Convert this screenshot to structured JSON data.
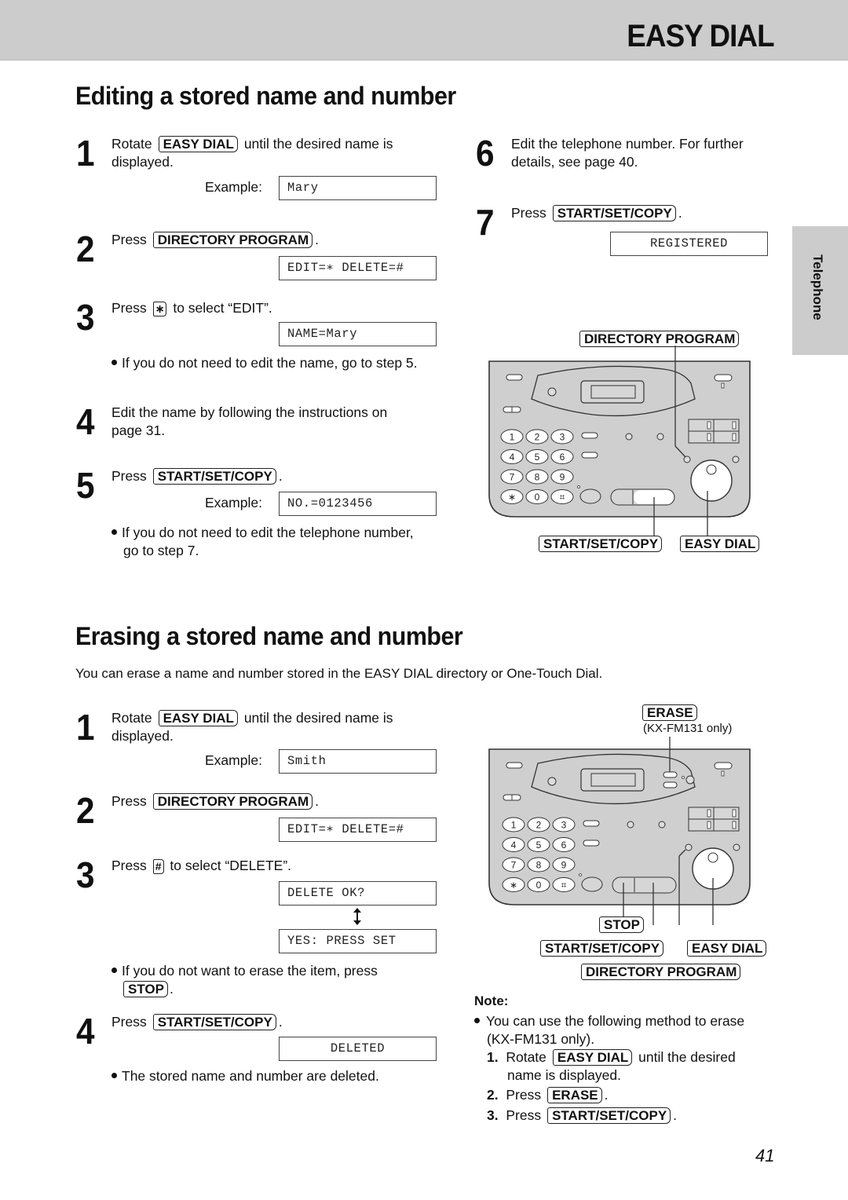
{
  "header": {
    "title": "EASY DIAL"
  },
  "side_tab": {
    "label": "Telephone"
  },
  "edit_section": {
    "title": "Editing a stored name and number",
    "steps": [
      {
        "num": "1",
        "before": "Rotate",
        "key": "EASY DIAL",
        "after": "until the desired name is",
        "line2": "displayed.",
        "example_label": "Example:",
        "lcd": "Mary"
      },
      {
        "num": "2",
        "before": "Press",
        "key": "DIRECTORY PROGRAM",
        "after": ".",
        "lcd": "EDIT=∗ DELETE=#"
      },
      {
        "num": "3",
        "before": "Press",
        "key": "∗",
        "after": "to select “EDIT”.",
        "lcd": "NAME=Mary",
        "bullet": "If you do not need to edit the name, go to step 5."
      },
      {
        "num": "4",
        "line1": "Edit the name by following the instructions on",
        "line2": "page 31."
      },
      {
        "num": "5",
        "before": "Press",
        "key": "START/SET/COPY",
        "after": ".",
        "example_label": "Example:",
        "lcd": "NO.=0123456",
        "bullet_line1": "If you do not need to edit the telephone number,",
        "bullet_line2": "go to step 7."
      },
      {
        "num": "6",
        "line1": "Edit the telephone number. For further",
        "line2": "details, see page 40."
      },
      {
        "num": "7",
        "before": "Press",
        "key": "START/SET/COPY",
        "after": ".",
        "lcd": "REGISTERED"
      }
    ],
    "diagram": {
      "callouts": [
        "DIRECTORY PROGRAM",
        "START/SET/COPY",
        "EASY DIAL"
      ],
      "keypad": [
        "1",
        "2",
        "3",
        "4",
        "5",
        "6",
        "7",
        "8",
        "9",
        "∗",
        "0",
        "⌗"
      ]
    }
  },
  "erase_section": {
    "title": "Erasing a stored name and number",
    "intro": "You can erase a name and number stored in the EASY DIAL directory or One-Touch Dial.",
    "steps": [
      {
        "num": "1",
        "before": "Rotate",
        "key": "EASY DIAL",
        "after": "until the desired name is",
        "line2": "displayed.",
        "example_label": "Example:",
        "lcd": "Smith"
      },
      {
        "num": "2",
        "before": "Press",
        "key": "DIRECTORY PROGRAM",
        "after": ".",
        "lcd": "EDIT=∗ DELETE=#"
      },
      {
        "num": "3",
        "before": "Press",
        "key": "#",
        "after": "to select “DELETE”.",
        "lcd": "DELETE OK?",
        "lcd2": "YES: PRESS SET",
        "bullet_line1": "If you do not want to erase the item, press",
        "bullet_key": "STOP",
        "bullet_after": "."
      },
      {
        "num": "4",
        "before": "Press",
        "key": "START/SET/COPY",
        "after": ".",
        "lcd": "DELETED",
        "bullet": "The stored name and number are deleted."
      }
    ],
    "diagram": {
      "erase_callout": "ERASE",
      "erase_sub": "(KX-FM131 only)",
      "callouts": [
        "STOP",
        "START/SET/COPY",
        "EASY DIAL",
        "DIRECTORY PROGRAM"
      ],
      "keypad": [
        "1",
        "2",
        "3",
        "4",
        "5",
        "6",
        "7",
        "8",
        "9",
        "∗",
        "0",
        "⌗"
      ]
    },
    "note": {
      "heading": "Note:",
      "bullet_line1": "You can use the following method to erase",
      "bullet_line2": "(KX-FM131 only).",
      "items": [
        {
          "num": "1.",
          "before": "Rotate",
          "key": "EASY DIAL",
          "after": "until the desired",
          "line2": "name is displayed."
        },
        {
          "num": "2.",
          "before": "Press",
          "key": "ERASE",
          "after": "."
        },
        {
          "num": "3.",
          "before": "Press",
          "key": "START/SET/COPY",
          "after": "."
        }
      ]
    }
  },
  "page_number": "41"
}
